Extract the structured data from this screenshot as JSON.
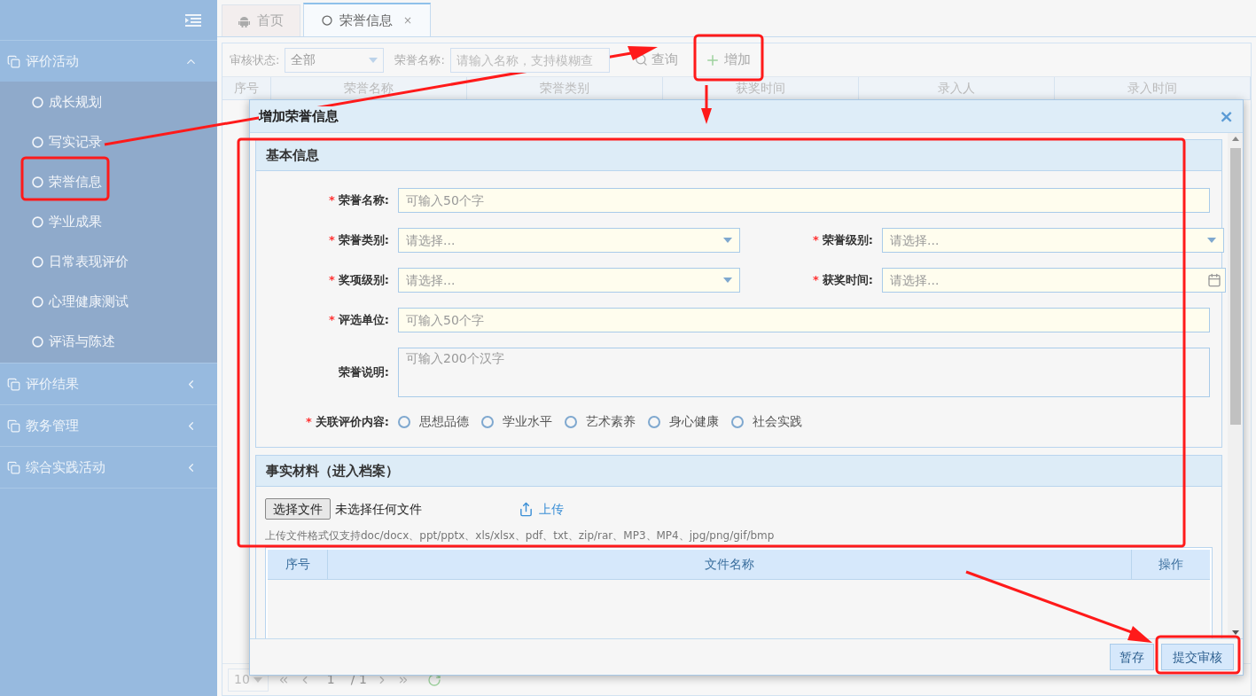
{
  "sidebar": {
    "groups": [
      {
        "label": "评价活动",
        "expanded": true,
        "items": [
          {
            "label": "成长规划"
          },
          {
            "label": "写实记录"
          },
          {
            "label": "荣誉信息"
          },
          {
            "label": "学业成果"
          },
          {
            "label": "日常表现评价"
          },
          {
            "label": "心理健康测试"
          },
          {
            "label": "评语与陈述"
          }
        ]
      },
      {
        "label": "评价结果",
        "expanded": false
      },
      {
        "label": "教务管理",
        "expanded": false
      },
      {
        "label": "综合实践活动",
        "expanded": false
      }
    ]
  },
  "tabs": [
    {
      "label": "首页",
      "selected": false,
      "kind": "home"
    },
    {
      "label": "荣誉信息",
      "selected": true,
      "kind": "page",
      "close": "×"
    }
  ],
  "toolbar": {
    "filters": [
      {
        "label": "审核状态:",
        "kind": "select",
        "value": "全部"
      },
      {
        "label": "荣誉名称:",
        "kind": "input",
        "placeholder": "请输入名称，支持模糊查"
      }
    ],
    "buttons": [
      {
        "label": "查询",
        "kind": "search"
      },
      {
        "label": "增加",
        "kind": "add"
      }
    ]
  },
  "table": {
    "columns": [
      "序号",
      "荣誉名称",
      "荣誉类别",
      "获奖时间",
      "录入人",
      "录入时间"
    ]
  },
  "pagination": {
    "page_size": "10",
    "page": "1",
    "total": "/ 1"
  },
  "dialog": {
    "title": "增加荣誉信息",
    "close": "×",
    "sections": [
      {
        "kind": "form",
        "title": "基本信息",
        "rows": [
          [
            {
              "label": "荣誉名称:",
              "mark": "*",
              "kind": "text",
              "placeholder": "可输入50个字"
            }
          ],
          [
            {
              "label": "荣誉类别:",
              "mark": "*",
              "kind": "select",
              "placeholder": "请选择..."
            },
            {
              "label": "荣誉级别:",
              "mark": "*",
              "kind": "select",
              "placeholder": "请选择..."
            }
          ],
          [
            {
              "label": "奖项级别:",
              "mark": "*",
              "kind": "select",
              "placeholder": "请选择..."
            },
            {
              "label": "获奖时间:",
              "mark": "*",
              "kind": "date",
              "placeholder": "请选择..."
            }
          ],
          [
            {
              "label": "评选单位:",
              "mark": "*",
              "kind": "text",
              "placeholder": "可输入50个字"
            }
          ],
          [
            {
              "label": "荣誉说明:",
              "kind": "textarea",
              "placeholder": "可输入200个汉字"
            }
          ],
          [
            {
              "label": "关联评价内容:",
              "mark": "*",
              "kind": "radio",
              "options": [
                {
                  "label": "思想品德",
                  "selected": false
                },
                {
                  "label": "学业水平",
                  "selected": false
                },
                {
                  "label": "艺术素养",
                  "selected": false
                },
                {
                  "label": "身心健康",
                  "selected": false
                },
                {
                  "label": "社会实践",
                  "selected": false
                }
              ]
            }
          ]
        ]
      },
      {
        "kind": "upload",
        "title": "事实材料（进入档案）",
        "choose_button": "选择文件",
        "file_status": "未选择任何文件",
        "upload_link": "上传",
        "hint": "上传文件格式仅支持doc/docx、ppt/pptx、xls/xlsx、pdf、txt、zip/rar、MP3、MP4、jpg/png/gif/bmp",
        "columns": [
          "序号",
          "文件名称",
          "操作"
        ]
      }
    ],
    "buttons": [
      {
        "label": "暂存",
        "kind": "secondary"
      },
      {
        "label": "提交审核",
        "kind": "primary"
      }
    ]
  }
}
